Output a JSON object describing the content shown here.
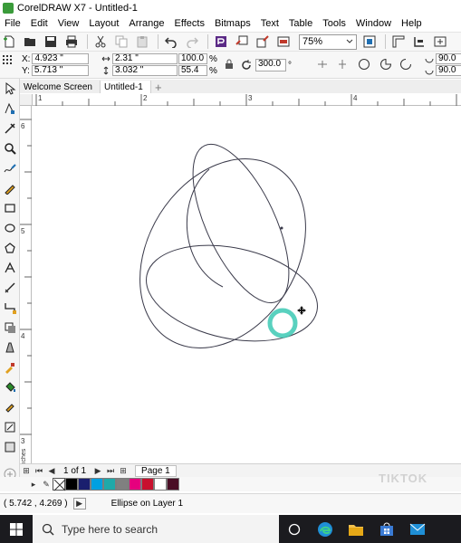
{
  "window": {
    "title": "CorelDRAW X7 - Untitled-1"
  },
  "menu": [
    "File",
    "Edit",
    "View",
    "Layout",
    "Arrange",
    "Effects",
    "Bitmaps",
    "Text",
    "Table",
    "Tools",
    "Window",
    "Help"
  ],
  "toolbar": {
    "zoom_value": "75%"
  },
  "propbar": {
    "x_label": "X:",
    "x_value": "4.923 \"",
    "y_label": "Y:",
    "y_value": "5.713 \"",
    "w_value": "2.31 \"",
    "h_value": "3.032 \"",
    "scale_w": "100.0",
    "scale_h": "55.4",
    "percent": "%",
    "rotation": "300.0",
    "degree": "°",
    "angle1": "90.0",
    "angle2": "90.0"
  },
  "tabs": [
    "Welcome Screen",
    "Untitled-1"
  ],
  "ruler": {
    "h_labels": [
      "1",
      "2",
      "3",
      "4",
      "5",
      "6"
    ],
    "v_labels": [
      "6",
      "5",
      "4",
      "3",
      "2"
    ],
    "unit": "inches"
  },
  "pagenav": {
    "count": "1 of 1",
    "page_tab": "Page 1"
  },
  "palette": {
    "colors": [
      "#000000",
      "#1a1f6e",
      "#00a0e0",
      "#1fa9a9",
      "#808080",
      "#e6007e",
      "#c8102e",
      "#ffffff",
      "#4a0e25"
    ]
  },
  "status": {
    "coords": "( 5.742 , 4.269 )",
    "object_info": "Ellipse on Layer 1"
  },
  "taskbar": {
    "search_placeholder": "Type here to search"
  },
  "watermark": "TIKTOK",
  "colors": {
    "cursor_highlight": "#3cc9b4",
    "taskbar_bg": "#1b1b1f"
  }
}
